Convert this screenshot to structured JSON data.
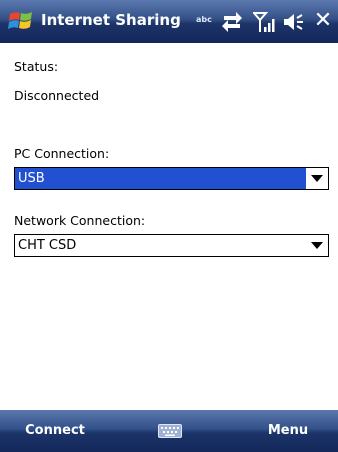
{
  "titlebar": {
    "title": "Internet Sharing",
    "indicator_text": "abc",
    "icons": [
      "windows-start-icon",
      "sync-arrows-icon",
      "signal-strength-icon",
      "volume-icon"
    ],
    "close_glyph": "✕"
  },
  "status": {
    "label": "Status:",
    "value": "Disconnected"
  },
  "pc_connection": {
    "label": "PC Connection:",
    "selected": "USB"
  },
  "network_connection": {
    "label": "Network Connection:",
    "selected": "CHT CSD"
  },
  "softkeys": {
    "left": "Connect",
    "right": "Menu",
    "center_icon": "keyboard-icon"
  },
  "colors": {
    "titlebar": "#1d3468",
    "selection": "#2150d0",
    "background": "#ffffff"
  }
}
